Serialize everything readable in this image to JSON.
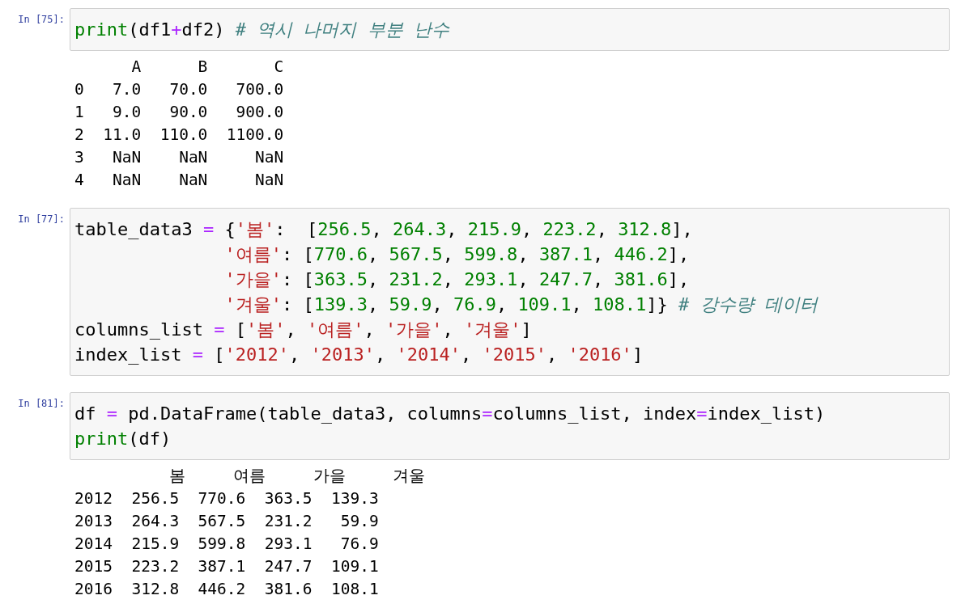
{
  "cells": [
    {
      "prompt": "In [75]:",
      "code": [
        {
          "indent": false,
          "tokens": [
            {
              "kind": "builtin",
              "text": "print"
            },
            {
              "kind": "name",
              "text": "(df1"
            },
            {
              "kind": "op",
              "text": "+"
            },
            {
              "kind": "name",
              "text": "df2) "
            },
            {
              "kind": "comment",
              "text": "# 역시 나머지 부분 난수"
            }
          ]
        }
      ],
      "output": [
        "      A      B       C",
        "0   7.0   70.0   700.0",
        "1   9.0   90.0   900.0",
        "2  11.0  110.0  1100.0",
        "3   NaN    NaN     NaN",
        "4   NaN    NaN     NaN"
      ]
    },
    {
      "prompt": "In [77]:",
      "code": [
        {
          "indent": false,
          "tokens": [
            {
              "kind": "name",
              "text": "table_data3 "
            },
            {
              "kind": "op",
              "text": "="
            },
            {
              "kind": "name",
              "text": " {"
            },
            {
              "kind": "str",
              "text": "'봄'"
            },
            {
              "kind": "name",
              "text": ":  ["
            },
            {
              "kind": "num",
              "text": "256.5"
            },
            {
              "kind": "name",
              "text": ", "
            },
            {
              "kind": "num",
              "text": "264.3"
            },
            {
              "kind": "name",
              "text": ", "
            },
            {
              "kind": "num",
              "text": "215.9"
            },
            {
              "kind": "name",
              "text": ", "
            },
            {
              "kind": "num",
              "text": "223.2"
            },
            {
              "kind": "name",
              "text": ", "
            },
            {
              "kind": "num",
              "text": "312.8"
            },
            {
              "kind": "name",
              "text": "],"
            }
          ]
        },
        {
          "indent": true,
          "tokens": [
            {
              "kind": "str",
              "text": "'여름'"
            },
            {
              "kind": "name",
              "text": ": ["
            },
            {
              "kind": "num",
              "text": "770.6"
            },
            {
              "kind": "name",
              "text": ", "
            },
            {
              "kind": "num",
              "text": "567.5"
            },
            {
              "kind": "name",
              "text": ", "
            },
            {
              "kind": "num",
              "text": "599.8"
            },
            {
              "kind": "name",
              "text": ", "
            },
            {
              "kind": "num",
              "text": "387.1"
            },
            {
              "kind": "name",
              "text": ", "
            },
            {
              "kind": "num",
              "text": "446.2"
            },
            {
              "kind": "name",
              "text": "],"
            }
          ]
        },
        {
          "indent": true,
          "tokens": [
            {
              "kind": "str",
              "text": "'가을'"
            },
            {
              "kind": "name",
              "text": ": ["
            },
            {
              "kind": "num",
              "text": "363.5"
            },
            {
              "kind": "name",
              "text": ", "
            },
            {
              "kind": "num",
              "text": "231.2"
            },
            {
              "kind": "name",
              "text": ", "
            },
            {
              "kind": "num",
              "text": "293.1"
            },
            {
              "kind": "name",
              "text": ", "
            },
            {
              "kind": "num",
              "text": "247.7"
            },
            {
              "kind": "name",
              "text": ", "
            },
            {
              "kind": "num",
              "text": "381.6"
            },
            {
              "kind": "name",
              "text": "],"
            }
          ]
        },
        {
          "indent": true,
          "tokens": [
            {
              "kind": "str",
              "text": "'겨울'"
            },
            {
              "kind": "name",
              "text": ": ["
            },
            {
              "kind": "num",
              "text": "139.3"
            },
            {
              "kind": "name",
              "text": ", "
            },
            {
              "kind": "num",
              "text": "59.9"
            },
            {
              "kind": "name",
              "text": ", "
            },
            {
              "kind": "num",
              "text": "76.9"
            },
            {
              "kind": "name",
              "text": ", "
            },
            {
              "kind": "num",
              "text": "109.1"
            },
            {
              "kind": "name",
              "text": ", "
            },
            {
              "kind": "num",
              "text": "108.1"
            },
            {
              "kind": "name",
              "text": "]} "
            },
            {
              "kind": "comment",
              "text": "# 강수량 데이터"
            }
          ]
        },
        {
          "indent": false,
          "tokens": [
            {
              "kind": "name",
              "text": "columns_list "
            },
            {
              "kind": "op",
              "text": "="
            },
            {
              "kind": "name",
              "text": " ["
            },
            {
              "kind": "str",
              "text": "'봄'"
            },
            {
              "kind": "name",
              "text": ", "
            },
            {
              "kind": "str",
              "text": "'여름'"
            },
            {
              "kind": "name",
              "text": ", "
            },
            {
              "kind": "str",
              "text": "'가을'"
            },
            {
              "kind": "name",
              "text": ", "
            },
            {
              "kind": "str",
              "text": "'겨울'"
            },
            {
              "kind": "name",
              "text": "]"
            }
          ]
        },
        {
          "indent": false,
          "tokens": [
            {
              "kind": "name",
              "text": "index_list "
            },
            {
              "kind": "op",
              "text": "="
            },
            {
              "kind": "name",
              "text": " ["
            },
            {
              "kind": "str",
              "text": "'2012'"
            },
            {
              "kind": "name",
              "text": ", "
            },
            {
              "kind": "str",
              "text": "'2013'"
            },
            {
              "kind": "name",
              "text": ", "
            },
            {
              "kind": "str",
              "text": "'2014'"
            },
            {
              "kind": "name",
              "text": ", "
            },
            {
              "kind": "str",
              "text": "'2015'"
            },
            {
              "kind": "name",
              "text": ", "
            },
            {
              "kind": "str",
              "text": "'2016'"
            },
            {
              "kind": "name",
              "text": "]"
            }
          ]
        }
      ]
    },
    {
      "prompt": "In [81]:",
      "code": [
        {
          "indent": false,
          "tokens": [
            {
              "kind": "name",
              "text": "df "
            },
            {
              "kind": "op",
              "text": "="
            },
            {
              "kind": "name",
              "text": " pd.DataFrame(table_data3, columns"
            },
            {
              "kind": "op",
              "text": "="
            },
            {
              "kind": "name",
              "text": "columns_list, index"
            },
            {
              "kind": "op",
              "text": "="
            },
            {
              "kind": "name",
              "text": "index_list)"
            }
          ]
        },
        {
          "indent": false,
          "tokens": [
            {
              "kind": "builtin",
              "text": "print"
            },
            {
              "kind": "name",
              "text": "(df)"
            }
          ]
        }
      ],
      "output": [
        "          봄     여름     가을     겨울",
        "2012  256.5  770.6  363.5  139.3",
        "2013  264.3  567.5  231.2   59.9",
        "2014  215.9  599.8  293.1   76.9",
        "2015  223.2  387.1  247.7  109.1",
        "2016  312.8  446.2  381.6  108.1"
      ]
    }
  ]
}
